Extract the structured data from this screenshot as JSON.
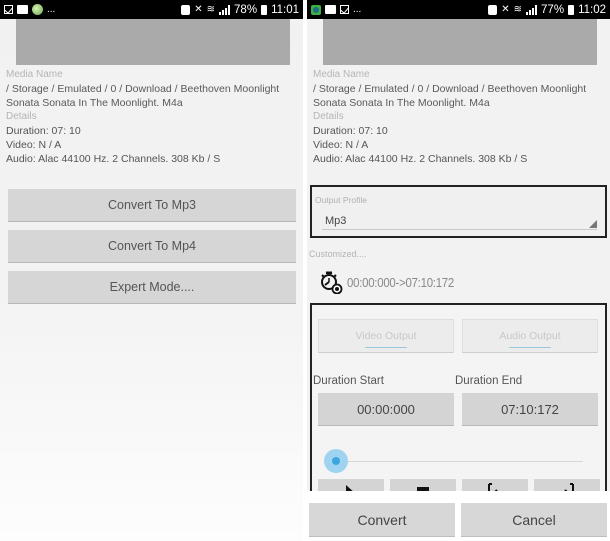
{
  "left_screen": {
    "statusbar": {
      "notification_icons": [
        "checkbox-icon",
        "image-icon",
        "globe-icon"
      ],
      "overflow": "...",
      "battery": "78%",
      "time": "11:01"
    },
    "media_name_label": "Media Name",
    "media_path_line1": "/ Storage / Emulated / 0 / Download / Beethoven Moonlight",
    "media_path_line2": "Sonata Sonata In The Moonlight. M4a",
    "details_label": "Details",
    "duration": "Duration: 07: 10",
    "video": "Video: N / A",
    "audio": "Audio: Alac 44100 Hz. 2 Channels. 308 Kb / S",
    "buttons": {
      "convert_mp3": "Convert To Mp3",
      "convert_mp4": "Convert To Mp4",
      "expert_mode": "Expert Mode...."
    }
  },
  "right_screen": {
    "statusbar": {
      "notification_icons": [
        "app-icon",
        "image-icon",
        "checkbox-icon"
      ],
      "overflow": "...",
      "battery": "77%",
      "time": "11:02"
    },
    "media_name_label": "Media Name",
    "media_path_line1": "/ Storage / Emulated / 0 / Download / Beethoven Moonlight",
    "media_path_line2": "Sonata Sonata In The Moonlight. M4a",
    "details_label": "Details",
    "duration": "Duration: 07: 10",
    "video": "Video: N / A",
    "audio": "Audio: Alac 44100 Hz. 2 Channels. 308 Kb / S",
    "output_profile": {
      "label": "Output Profile",
      "value": "Mp3"
    },
    "customized_label": "Customized....",
    "time_range": "00:00:000->07:10:172",
    "tabs": {
      "video_output": "Video Output",
      "audio_output": "Audio Output"
    },
    "duration_start_label": "Duration Start",
    "duration_start_value": "00:00:000",
    "duration_end_label": "Duration End",
    "duration_end_value": "07:10:172",
    "seek_position_fraction": 0.0,
    "controls": [
      "play",
      "stop",
      "set-start",
      "set-end"
    ],
    "accent_color": "#3aa6dd",
    "buttons": {
      "convert": "Convert",
      "cancel": "Cancel"
    }
  }
}
